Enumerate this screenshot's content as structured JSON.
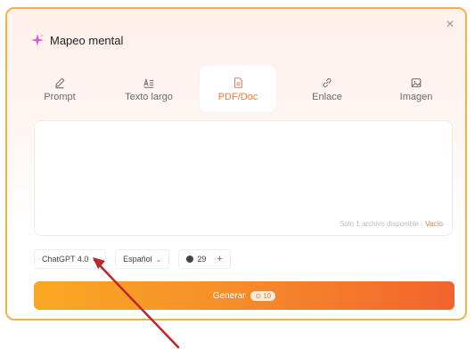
{
  "dialog": {
    "title": "Mapeo mental",
    "close_icon": "close-icon",
    "accent_color": "#f07a3a",
    "border_color": "#f2b24a"
  },
  "tabs": [
    {
      "label": "Prompt",
      "icon": "pen-icon",
      "active": false
    },
    {
      "label": "Texto largo",
      "icon": "text-icon",
      "active": false
    },
    {
      "label": "PDF/Doc",
      "icon": "document-icon",
      "active": true
    },
    {
      "label": "Enlace",
      "icon": "link-icon",
      "active": false
    },
    {
      "label": "Imagen",
      "icon": "image-icon",
      "active": false
    }
  ],
  "input": {
    "status_text": "Solo 1 archivo disponible · ",
    "clear_label": "Vacío"
  },
  "controls": {
    "model_label": "ChatGPT 4.0",
    "language_label": "Español",
    "credits": "29"
  },
  "generate": {
    "label": "Generar",
    "cost": "10"
  },
  "annotation": {
    "arrow_color": "#c0242b"
  }
}
